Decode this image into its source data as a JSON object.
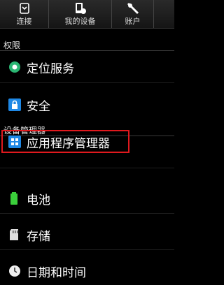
{
  "tabs": [
    {
      "label": "连接",
      "icon": "connect-icon"
    },
    {
      "label": "我的设备",
      "icon": "my-device-icon"
    },
    {
      "label": "账户",
      "icon": "account-icon"
    }
  ],
  "sections": {
    "permissions": "权限",
    "device_management": "设备管理器"
  },
  "items": [
    {
      "label": "定位服务",
      "icon": "location-icon",
      "color": "#2bb673"
    },
    {
      "label": "安全",
      "icon": "lock-icon",
      "color": "#1e88e5"
    },
    {
      "label": "应用程序管理器",
      "icon": "app-grid-icon",
      "color": "#1e88e5"
    },
    {
      "label": "电池",
      "icon": "battery-icon",
      "color": "#3bcf3b"
    },
    {
      "label": "存储",
      "icon": "storage-icon",
      "color": "#ddd"
    },
    {
      "label": "日期和时间",
      "icon": "clock-icon",
      "color": "#eee"
    }
  ],
  "highlight_color": "#e0191e"
}
